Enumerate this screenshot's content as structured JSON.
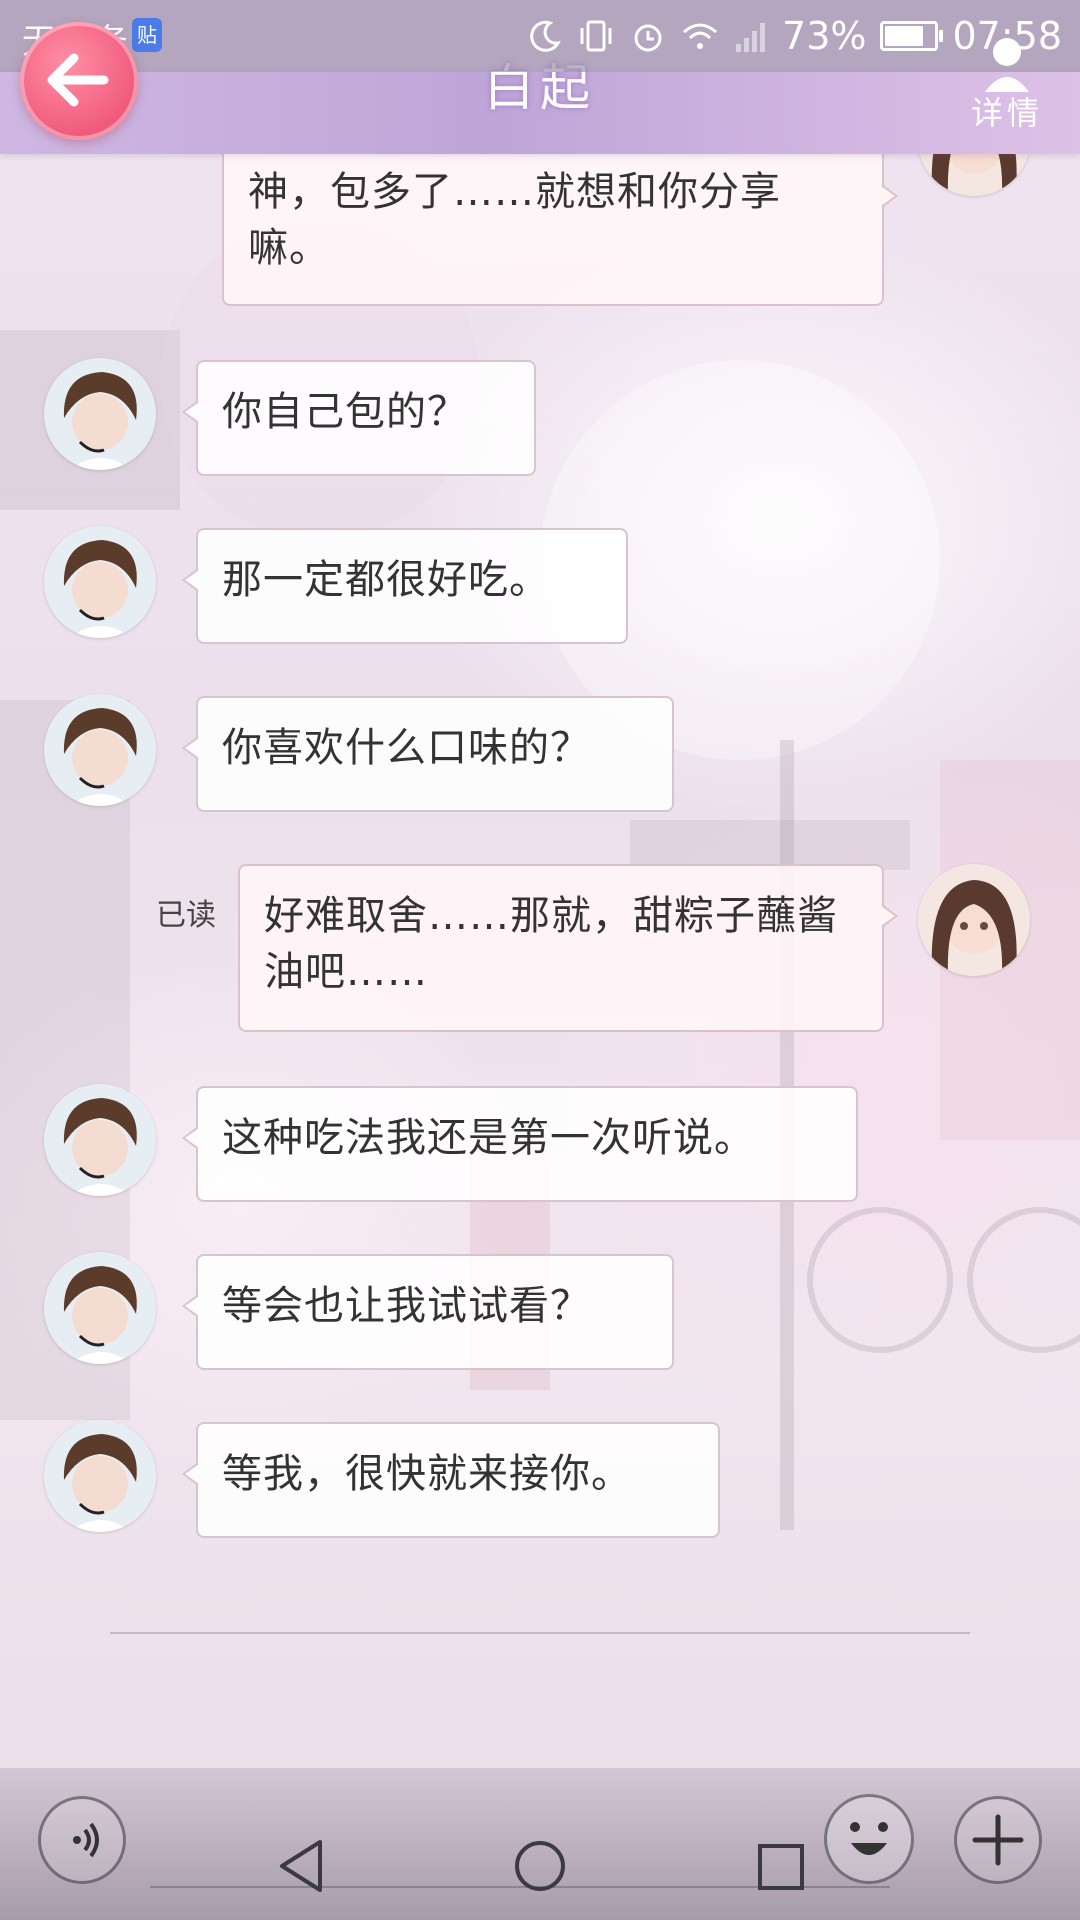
{
  "status_bar": {
    "carrier": "无服务",
    "badge": "贴",
    "battery_percent": "73%",
    "battery_level": 0.73,
    "time": "07:58"
  },
  "header": {
    "title": "白起",
    "details_label": "详情"
  },
  "messages": [
    {
      "sender": "self",
      "text": "神，包多了……就想和你分享嘛。"
    },
    {
      "sender": "other",
      "text": "你自己包的？"
    },
    {
      "sender": "other",
      "text": "那一定都很好吃。"
    },
    {
      "sender": "other",
      "text": "你喜欢什么口味的？"
    },
    {
      "sender": "self",
      "text": "好难取舍……那就，甜粽子蘸酱油吧……",
      "read_label": "已读"
    },
    {
      "sender": "other",
      "text": "这种吃法我还是第一次听说。"
    },
    {
      "sender": "other",
      "text": "等会也让我试试看？"
    },
    {
      "sender": "other",
      "text": "等我，很快就来接你。"
    }
  ],
  "icons": {
    "back": "back-arrow-icon",
    "details": "person-icon",
    "voice": "voice-icon",
    "emoji": "emoji-icon",
    "add": "plus-icon"
  },
  "colors": {
    "back_button": "#f05a7c",
    "header": "#c4aadc",
    "bubble_border": "#d6c4d0"
  }
}
